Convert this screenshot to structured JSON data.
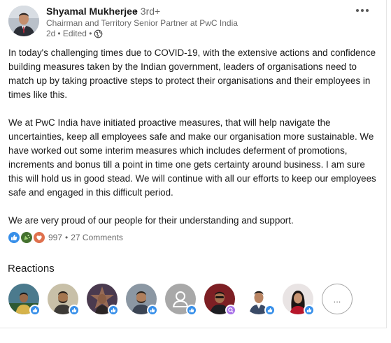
{
  "author": {
    "name": "Shyamal Mukherjee",
    "degree": "• 3rd+",
    "headline": "Chairman and Territory Senior Partner at PwC India",
    "time": "2d",
    "edited": "• Edited •"
  },
  "post": {
    "paragraphs": [
      "In today's challenging times due to COVID-19, with the extensive actions and confidence building measures taken by the Indian government, leaders of organisations need to match up by taking proactive steps to protect their organisations and their employees in times like this.",
      "We at PwC India have initiated proactive measures, that will help navigate the uncertainties, keep all employees safe and make our organisation more sustainable. We have worked out some interim measures which includes deferment of promotions, increments and bonus till a point in time one gets certainty around business. I am sure this will hold us in good stead. We will continue with all our efforts to keep our employees safe and engaged in this difficult period.",
      "We are very proud of our people for their understanding and support."
    ]
  },
  "social": {
    "reaction_icons": [
      "like-icon",
      "celebrate-icon",
      "love-icon"
    ],
    "reaction_count": "997",
    "separator": "•",
    "comments": "27 Comments"
  },
  "reactions": {
    "title": "Reactions",
    "more_label": "...",
    "reactors": [
      {
        "badge": "like-icon"
      },
      {
        "badge": "like-icon"
      },
      {
        "badge": "like-icon"
      },
      {
        "badge": "like-icon"
      },
      {
        "badge": "like-icon"
      },
      {
        "badge": "curious-icon"
      },
      {
        "badge": "like-icon"
      },
      {
        "badge": "like-icon"
      }
    ]
  },
  "colors": {
    "like": "#378fe9",
    "celebrate": "#44712e",
    "love": "#df704d",
    "curious": "#a872e8",
    "text_secondary": "#666666"
  }
}
